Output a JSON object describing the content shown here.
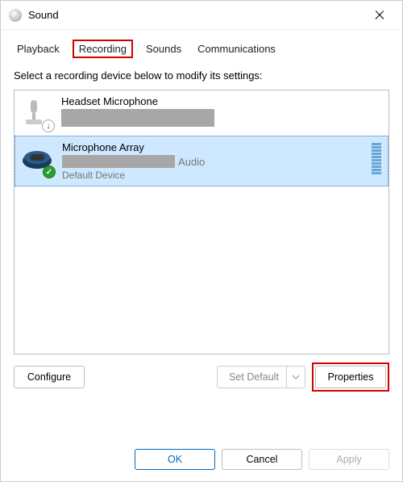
{
  "window": {
    "title": "Sound"
  },
  "tabs": {
    "playback": "Playback",
    "recording": "Recording",
    "sounds": "Sounds",
    "communications": "Communications",
    "active": "Recording",
    "highlighted": "Recording"
  },
  "instruction": "Select a recording device below to modify its settings:",
  "devices": [
    {
      "name": "Headset Microphone",
      "description_redacted": true,
      "status": "",
      "badge": "down-arrow",
      "selected": false
    },
    {
      "name": "Microphone Array",
      "description_suffix": "Audio",
      "description_redacted": true,
      "status": "Default Device",
      "badge": "check",
      "selected": true
    }
  ],
  "buttons": {
    "configure": "Configure",
    "set_default": "Set Default",
    "properties": "Properties",
    "highlighted": "Properties"
  },
  "footer": {
    "ok": "OK",
    "cancel": "Cancel",
    "apply": "Apply"
  },
  "icons": {
    "close": "close-icon",
    "dropdown": "chevron-down-icon",
    "sound": "sound-icon",
    "headset_mic": "headset-mic-icon",
    "mic_array": "mic-array-icon",
    "down_arrow_badge": "down-arrow-badge-icon",
    "check_badge": "check-badge-icon"
  },
  "colors": {
    "highlight": "#d40000",
    "selection_bg": "#cde8ff",
    "accent": "#0067c0"
  }
}
